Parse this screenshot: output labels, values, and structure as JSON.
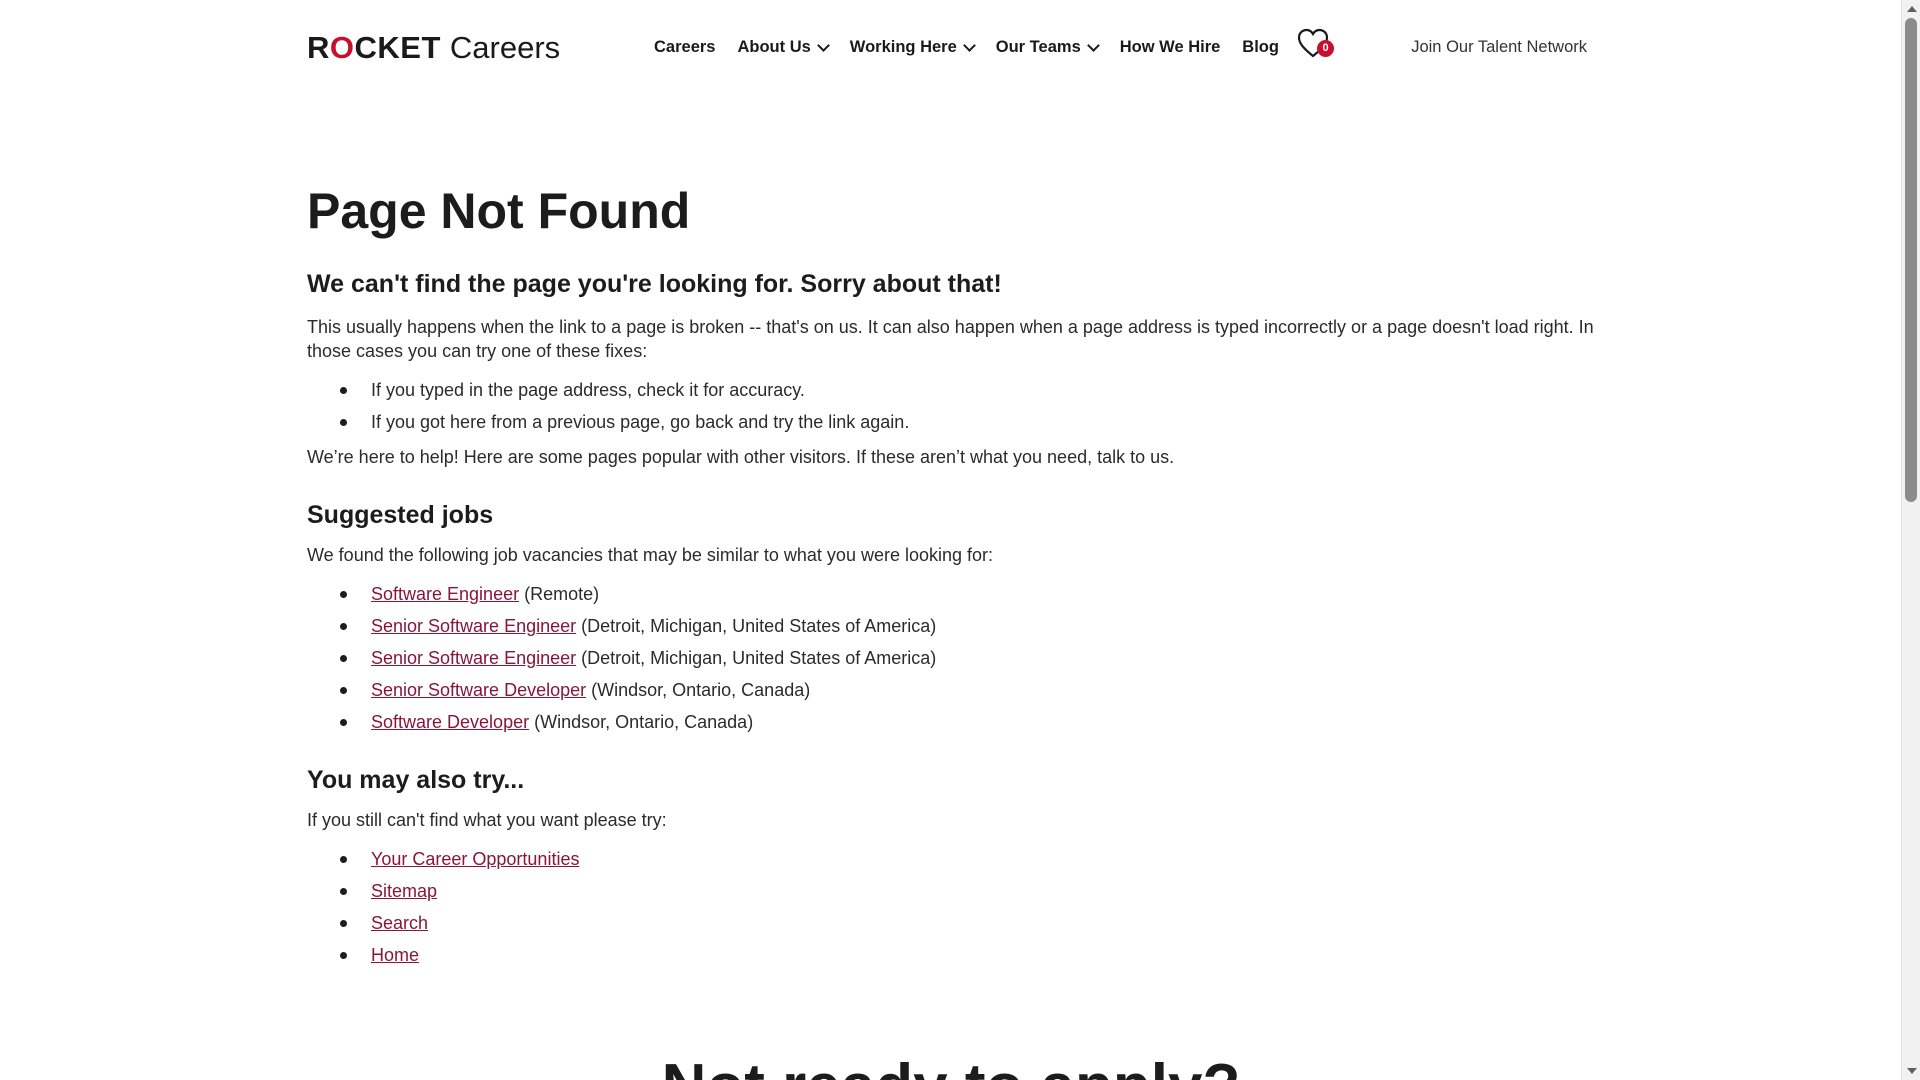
{
  "header": {
    "logo_rocket_pre": "R",
    "logo_rocket_o": "O",
    "logo_rocket_post": "CKET",
    "logo_careers": "Careers",
    "nav": [
      {
        "label": "Careers",
        "dropdown": false
      },
      {
        "label": "About Us",
        "dropdown": true
      },
      {
        "label": "Working Here",
        "dropdown": true
      },
      {
        "label": "Our Teams",
        "dropdown": true
      },
      {
        "label": "How We Hire",
        "dropdown": false
      },
      {
        "label": "Blog",
        "dropdown": false
      }
    ],
    "saved_jobs_count": "0",
    "talent_network": "Join Our Talent Network"
  },
  "main": {
    "title": "Page Not Found",
    "subtitle": "We can't find the page you're looking for. Sorry about that!",
    "intro": "This usually happens when the link to a page is broken -- that's on us. It can also happen when a page address is typed incorrectly or a page doesn't load right. In those cases you can try one of these fixes:",
    "fixes": [
      "If you typed in the page address, check it for accuracy.",
      "If you got here from a previous page, go back and try the link again."
    ],
    "help": "We’re here to help! Here are some pages popular with other visitors. If these aren’t what you need, talk to us.",
    "suggested": {
      "heading": "Suggested jobs",
      "lead": "We found the following job vacancies that may be similar to what you were looking for:",
      "jobs": [
        {
          "title": "Software Engineer",
          "location": " (Remote)"
        },
        {
          "title": "Senior Software Engineer",
          "location": " (Detroit, Michigan, United States of America)"
        },
        {
          "title": "Senior Software Engineer",
          "location": " (Detroit, Michigan, United States of America)"
        },
        {
          "title": "Senior Software Developer",
          "location": " (Windsor, Ontario, Canada)"
        },
        {
          "title": "Software Developer",
          "location": " (Windsor, Ontario, Canada)"
        }
      ]
    },
    "also_try": {
      "heading": "You may also try...",
      "lead": "If you still can't find what you want please try:",
      "links": [
        "Your Career Opportunities",
        "Sitemap",
        "Search",
        "Home"
      ]
    },
    "bottom_heading": "Not ready to apply?"
  },
  "colors": {
    "brand_red": "#c8102e",
    "link": "#8a1538",
    "text": "#1c1c1c"
  },
  "icons": {
    "saved_jobs": "heart-icon",
    "dropdown": "chevron-down-icon"
  }
}
